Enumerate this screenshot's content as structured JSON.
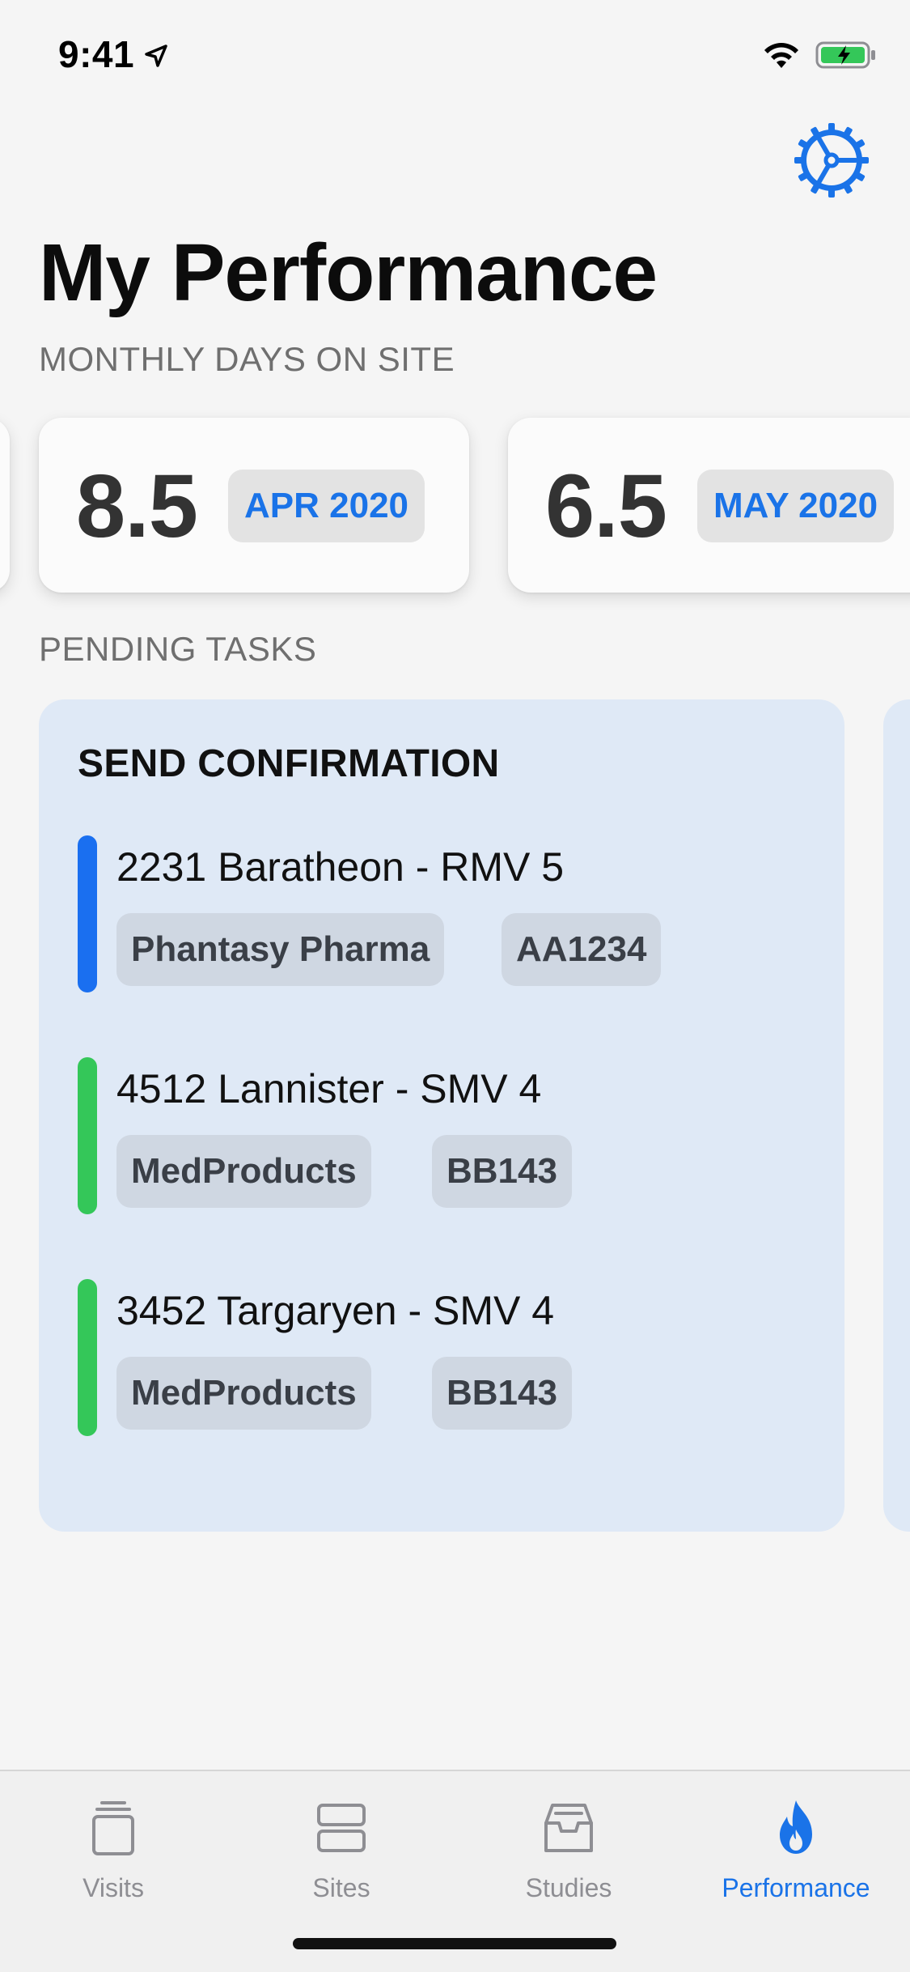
{
  "status_bar": {
    "time": "9:41"
  },
  "page": {
    "title": "My Performance"
  },
  "monthly": {
    "label": "MONTHLY DAYS ON SITE",
    "cards": [
      {
        "value": "8.5",
        "month": "APR 2020"
      },
      {
        "value": "6.5",
        "month": "MAY 2020"
      }
    ]
  },
  "pending": {
    "label": "PENDING TASKS",
    "card": {
      "heading": "SEND CONFIRMATION",
      "items": [
        {
          "title": "2231 Baratheon - RMV 5",
          "tags": [
            "Phantasy Pharma",
            "AA1234"
          ],
          "color": "#1a6ff0"
        },
        {
          "title": "4512 Lannister - SMV 4",
          "tags": [
            "MedProducts",
            "BB143"
          ],
          "color": "#34c759"
        },
        {
          "title": "3452 Targaryen - SMV 4",
          "tags": [
            "MedProducts",
            "BB143"
          ],
          "color": "#34c759"
        }
      ]
    }
  },
  "tabs": [
    {
      "label": "Visits",
      "icon": "visits-stack-icon",
      "active": false
    },
    {
      "label": "Sites",
      "icon": "sites-icon",
      "active": false
    },
    {
      "label": "Studies",
      "icon": "studies-tray-icon",
      "active": false
    },
    {
      "label": "Performance",
      "icon": "flame-icon",
      "active": true
    }
  ],
  "colors": {
    "accent": "#1a73e8",
    "task_card_bg": "#dfe9f6",
    "background": "#f5f5f5"
  }
}
